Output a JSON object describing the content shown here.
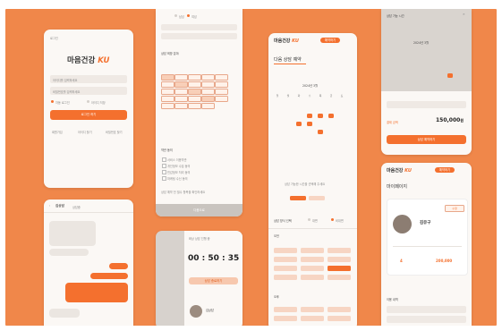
{
  "brand": {
    "name": "마음건강",
    "mark": "KU"
  },
  "login": {
    "back": "로그인",
    "id_placeholder": "아이디를 입력하세요",
    "pw_placeholder": "비밀번호를 입력하세요",
    "remember": "자동 로그인",
    "save_id": "아이디 저장",
    "login_button": "로그인 하기",
    "links": [
      "회원가입",
      "아이디 찾기",
      "비밀번호 찾기"
    ]
  },
  "signup": {
    "gender": [
      "남성",
      "여성"
    ],
    "section_title": "상담 희망 분야",
    "agree_title": "약관 동의",
    "agree_items": [
      "서비스 이용약관",
      "개인정보 수집 동의",
      "민감정보 처리 동의",
      "마케팅 수신 동의"
    ],
    "note": "상담 예약 전 필수 항목을 확인하세요",
    "next_button": "다음으로"
  },
  "booking": {
    "title": "다음 상담 예약",
    "button": "예약하기",
    "month": "2024년 3월",
    "weekdays": [
      "일",
      "월",
      "화",
      "수",
      "목",
      "금",
      "토"
    ],
    "notice": "상담 가능한 시간을 선택해 주세요",
    "method_label": "상담 방식 선택",
    "method_options": [
      "대면",
      "비대면"
    ],
    "section_am": "오전",
    "section_pm": "오후"
  },
  "timer": {
    "header": "화상 상담 진행 중",
    "time": "00 : 50 : 35",
    "end_button": "상담 종료하기",
    "counselor": "김상담"
  },
  "chat": {
    "title": "김상담",
    "status": "상담중"
  },
  "payment": {
    "title": "상담 가능 시간",
    "month": "2024년 3월",
    "label": "결제 금액",
    "price": "150,000",
    "unit": "원",
    "pay_button": "상담 예약하기"
  },
  "mypage": {
    "title": "마이페이지",
    "edit": "수정",
    "name": "김유구",
    "count_value": "4",
    "amount_value": "200,000",
    "section": "이용 내역"
  },
  "colors": {
    "accent": "#f4702e",
    "background": "#f0874a"
  }
}
